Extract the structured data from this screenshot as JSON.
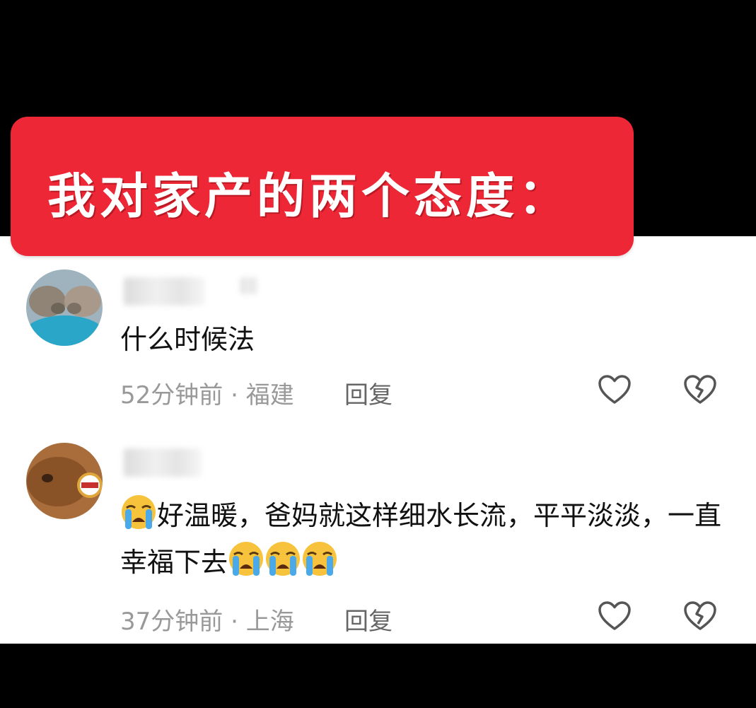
{
  "banner": {
    "title": "我对家产的两个态度："
  },
  "comments": [
    {
      "text": "什么时候法",
      "time": "52分钟前",
      "separator": "·",
      "location": "福建",
      "reply_label": "回复"
    },
    {
      "text_emoji_lead": "loudly-crying-face",
      "text_part1": "好温暖，爸妈就这样细水长流，平平淡淡，一直幸福下去",
      "text_emoji_trail": [
        "loudly-crying-face",
        "loudly-crying-face",
        "loudly-crying-face"
      ],
      "time": "37分钟前",
      "separator": "·",
      "location": "上海",
      "reply_label": "回复"
    }
  ],
  "colors": {
    "banner": "#ee2737",
    "meta": "#999999"
  }
}
